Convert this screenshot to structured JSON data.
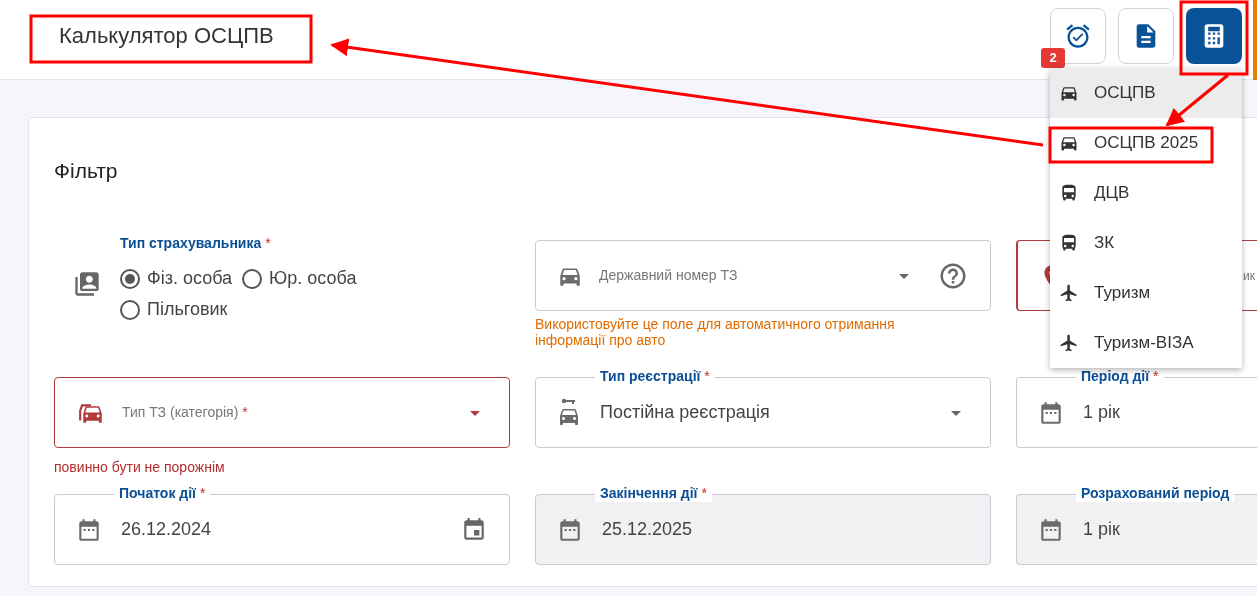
{
  "header": {
    "title": "Калькулятор ОСЦПВ",
    "badge": "2",
    "buttons": [
      {
        "kind": "alarm",
        "selected": false
      },
      {
        "kind": "document",
        "selected": false
      },
      {
        "kind": "calculator",
        "selected": true
      }
    ]
  },
  "menu": {
    "items": [
      {
        "label": "ОСЦПВ",
        "kind": "car",
        "selected": true
      },
      {
        "label": "ОСЦПВ 2025",
        "kind": "car",
        "selected": false
      },
      {
        "label": "ДЦВ",
        "kind": "bus",
        "selected": false
      },
      {
        "label": "ЗК",
        "kind": "bus",
        "selected": false
      },
      {
        "label": "Туризм",
        "kind": "plane",
        "selected": false
      },
      {
        "label": "Туризм-ВІЗА",
        "kind": "plane",
        "selected": false
      }
    ]
  },
  "filter": {
    "title": "Фільтр",
    "insurer_type": {
      "label": "Тип страхувальника",
      "required_mark": "*",
      "options": [
        {
          "label": "Фіз. особа",
          "selected": true
        },
        {
          "label": "Юр. особа",
          "selected": false
        },
        {
          "label": "Пільговик",
          "selected": false
        }
      ]
    },
    "rows": [
      [
        {
          "kind": "radio"
        },
        {
          "kind": "plate",
          "placeholder": "Державний номер ТЗ",
          "hint": "Використовуйте це поле для автоматичного отримання інформації про авто"
        },
        {
          "kind": "location",
          "placeholder": "ик",
          "error": true
        }
      ],
      [
        {
          "kind": "vehicle-type",
          "placeholder": "Тип ТЗ (категорія)",
          "placeholder_mark": "*",
          "error": true,
          "error_message": "повинно бути не порожнім"
        },
        {
          "kind": "registration",
          "label": "Тип реєстрації",
          "required_mark": "*",
          "value": "Постійна реєстрація"
        },
        {
          "kind": "period",
          "label": "Період дії",
          "required_mark": "*",
          "value": "1 рік"
        }
      ],
      [
        {
          "kind": "start-date",
          "label": "Початок дії",
          "required_mark": "*",
          "value": "26.12.2024"
        },
        {
          "kind": "end-date",
          "label": "Закінчення дії",
          "required_mark": "*",
          "value": "25.12.2025",
          "disabled": true
        },
        {
          "kind": "computed-period",
          "label": "Розрахований період",
          "value": "1 рік",
          "disabled": true
        }
      ]
    ]
  }
}
